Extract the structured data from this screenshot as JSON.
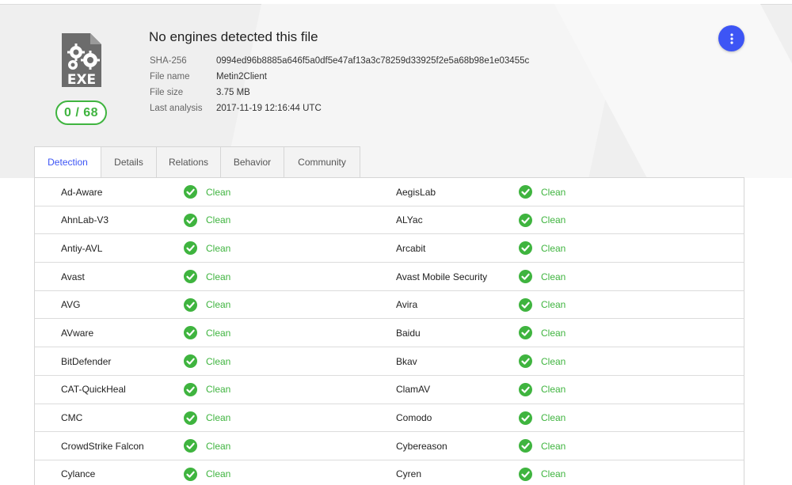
{
  "header": {
    "title": "No engines detected this file",
    "score": "0 / 68",
    "file_type": "EXE",
    "meta": [
      {
        "key": "SHA-256",
        "value": "0994ed96b8885a646f5a0df5e47af13a3c78259d33925f2e5a68b98e1e03455c"
      },
      {
        "key": "File name",
        "value": "Metin2Client"
      },
      {
        "key": "File size",
        "value": "3.75 MB"
      },
      {
        "key": "Last analysis",
        "value": "2017-11-19 12:16:44 UTC"
      }
    ]
  },
  "tabs": [
    {
      "label": "Detection",
      "active": true
    },
    {
      "label": "Details",
      "active": false
    },
    {
      "label": "Relations",
      "active": false
    },
    {
      "label": "Behavior",
      "active": false
    },
    {
      "label": "Community",
      "active": false
    }
  ],
  "colors": {
    "accent": "#3d55f5",
    "clean": "#3fb43f",
    "header_bg": "#efefef"
  },
  "results": [
    {
      "left": {
        "engine": "Ad-Aware",
        "status": "Clean"
      },
      "right": {
        "engine": "AegisLab",
        "status": "Clean"
      }
    },
    {
      "left": {
        "engine": "AhnLab-V3",
        "status": "Clean"
      },
      "right": {
        "engine": "ALYac",
        "status": "Clean"
      }
    },
    {
      "left": {
        "engine": "Antiy-AVL",
        "status": "Clean"
      },
      "right": {
        "engine": "Arcabit",
        "status": "Clean"
      }
    },
    {
      "left": {
        "engine": "Avast",
        "status": "Clean"
      },
      "right": {
        "engine": "Avast Mobile Security",
        "status": "Clean"
      }
    },
    {
      "left": {
        "engine": "AVG",
        "status": "Clean"
      },
      "right": {
        "engine": "Avira",
        "status": "Clean"
      }
    },
    {
      "left": {
        "engine": "AVware",
        "status": "Clean"
      },
      "right": {
        "engine": "Baidu",
        "status": "Clean"
      }
    },
    {
      "left": {
        "engine": "BitDefender",
        "status": "Clean"
      },
      "right": {
        "engine": "Bkav",
        "status": "Clean"
      }
    },
    {
      "left": {
        "engine": "CAT-QuickHeal",
        "status": "Clean"
      },
      "right": {
        "engine": "ClamAV",
        "status": "Clean"
      }
    },
    {
      "left": {
        "engine": "CMC",
        "status": "Clean"
      },
      "right": {
        "engine": "Comodo",
        "status": "Clean"
      }
    },
    {
      "left": {
        "engine": "CrowdStrike Falcon",
        "status": "Clean"
      },
      "right": {
        "engine": "Cybereason",
        "status": "Clean"
      }
    },
    {
      "left": {
        "engine": "Cylance",
        "status": "Clean"
      },
      "right": {
        "engine": "Cyren",
        "status": "Clean"
      }
    }
  ],
  "icons": {
    "file": "exe-file-icon",
    "menu": "more-vertical-icon",
    "status": "check-circle-icon"
  }
}
